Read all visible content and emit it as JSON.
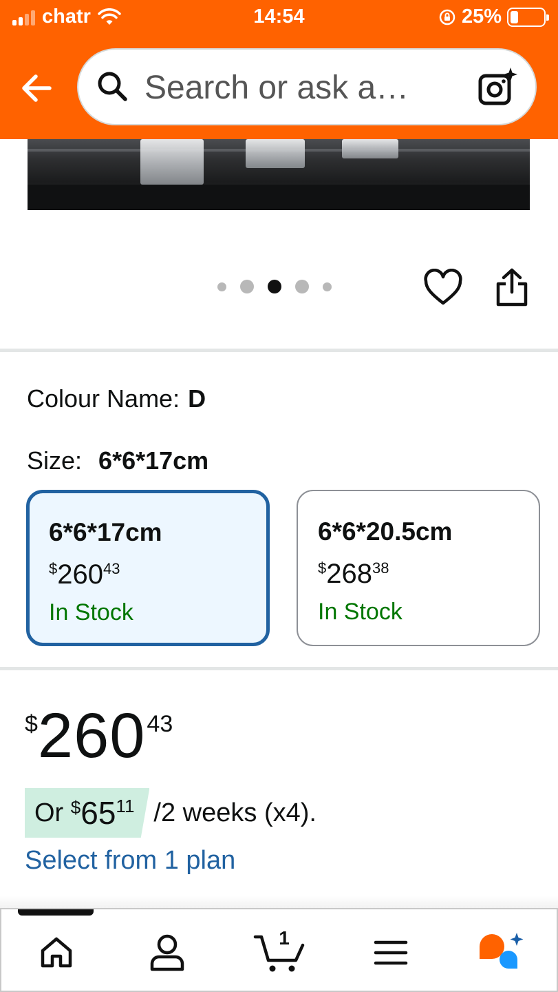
{
  "status_bar": {
    "carrier": "chatr",
    "time": "14:54",
    "battery_percent": "25%"
  },
  "header": {
    "search_placeholder": "Search or ask a…"
  },
  "carousel": {
    "total_dots": 5,
    "active_index": 2
  },
  "variants": {
    "colour_label": "Colour Name:",
    "colour_value": "D",
    "size_label": "Size:",
    "size_value": "6*6*17cm",
    "options": [
      {
        "title": "6*6*17cm",
        "currency": "$",
        "price_whole": "260",
        "price_fraction": "43",
        "stock": "In Stock",
        "selected": true
      },
      {
        "title": "6*6*20.5cm",
        "currency": "$",
        "price_whole": "268",
        "price_fraction": "38",
        "stock": "In Stock",
        "selected": false
      }
    ]
  },
  "price": {
    "currency": "$",
    "whole": "260",
    "fraction": "43"
  },
  "installment": {
    "prefix": "Or",
    "currency": "$",
    "whole": "65",
    "fraction": "11",
    "suffix": "/2 weeks (x4).",
    "plan_link": "Select from 1 plan"
  },
  "bottom_nav": {
    "cart_count": "1",
    "items": [
      "home-icon",
      "account-icon",
      "cart-icon",
      "menu-icon",
      "rufus-assistant-icon"
    ]
  },
  "colors": {
    "header_bg": "#ff6200",
    "selected_border": "#2162a1",
    "selected_bg": "#edf7ff",
    "in_stock": "#007600",
    "link": "#2162a1",
    "installment_badge": "#cfeee0"
  }
}
